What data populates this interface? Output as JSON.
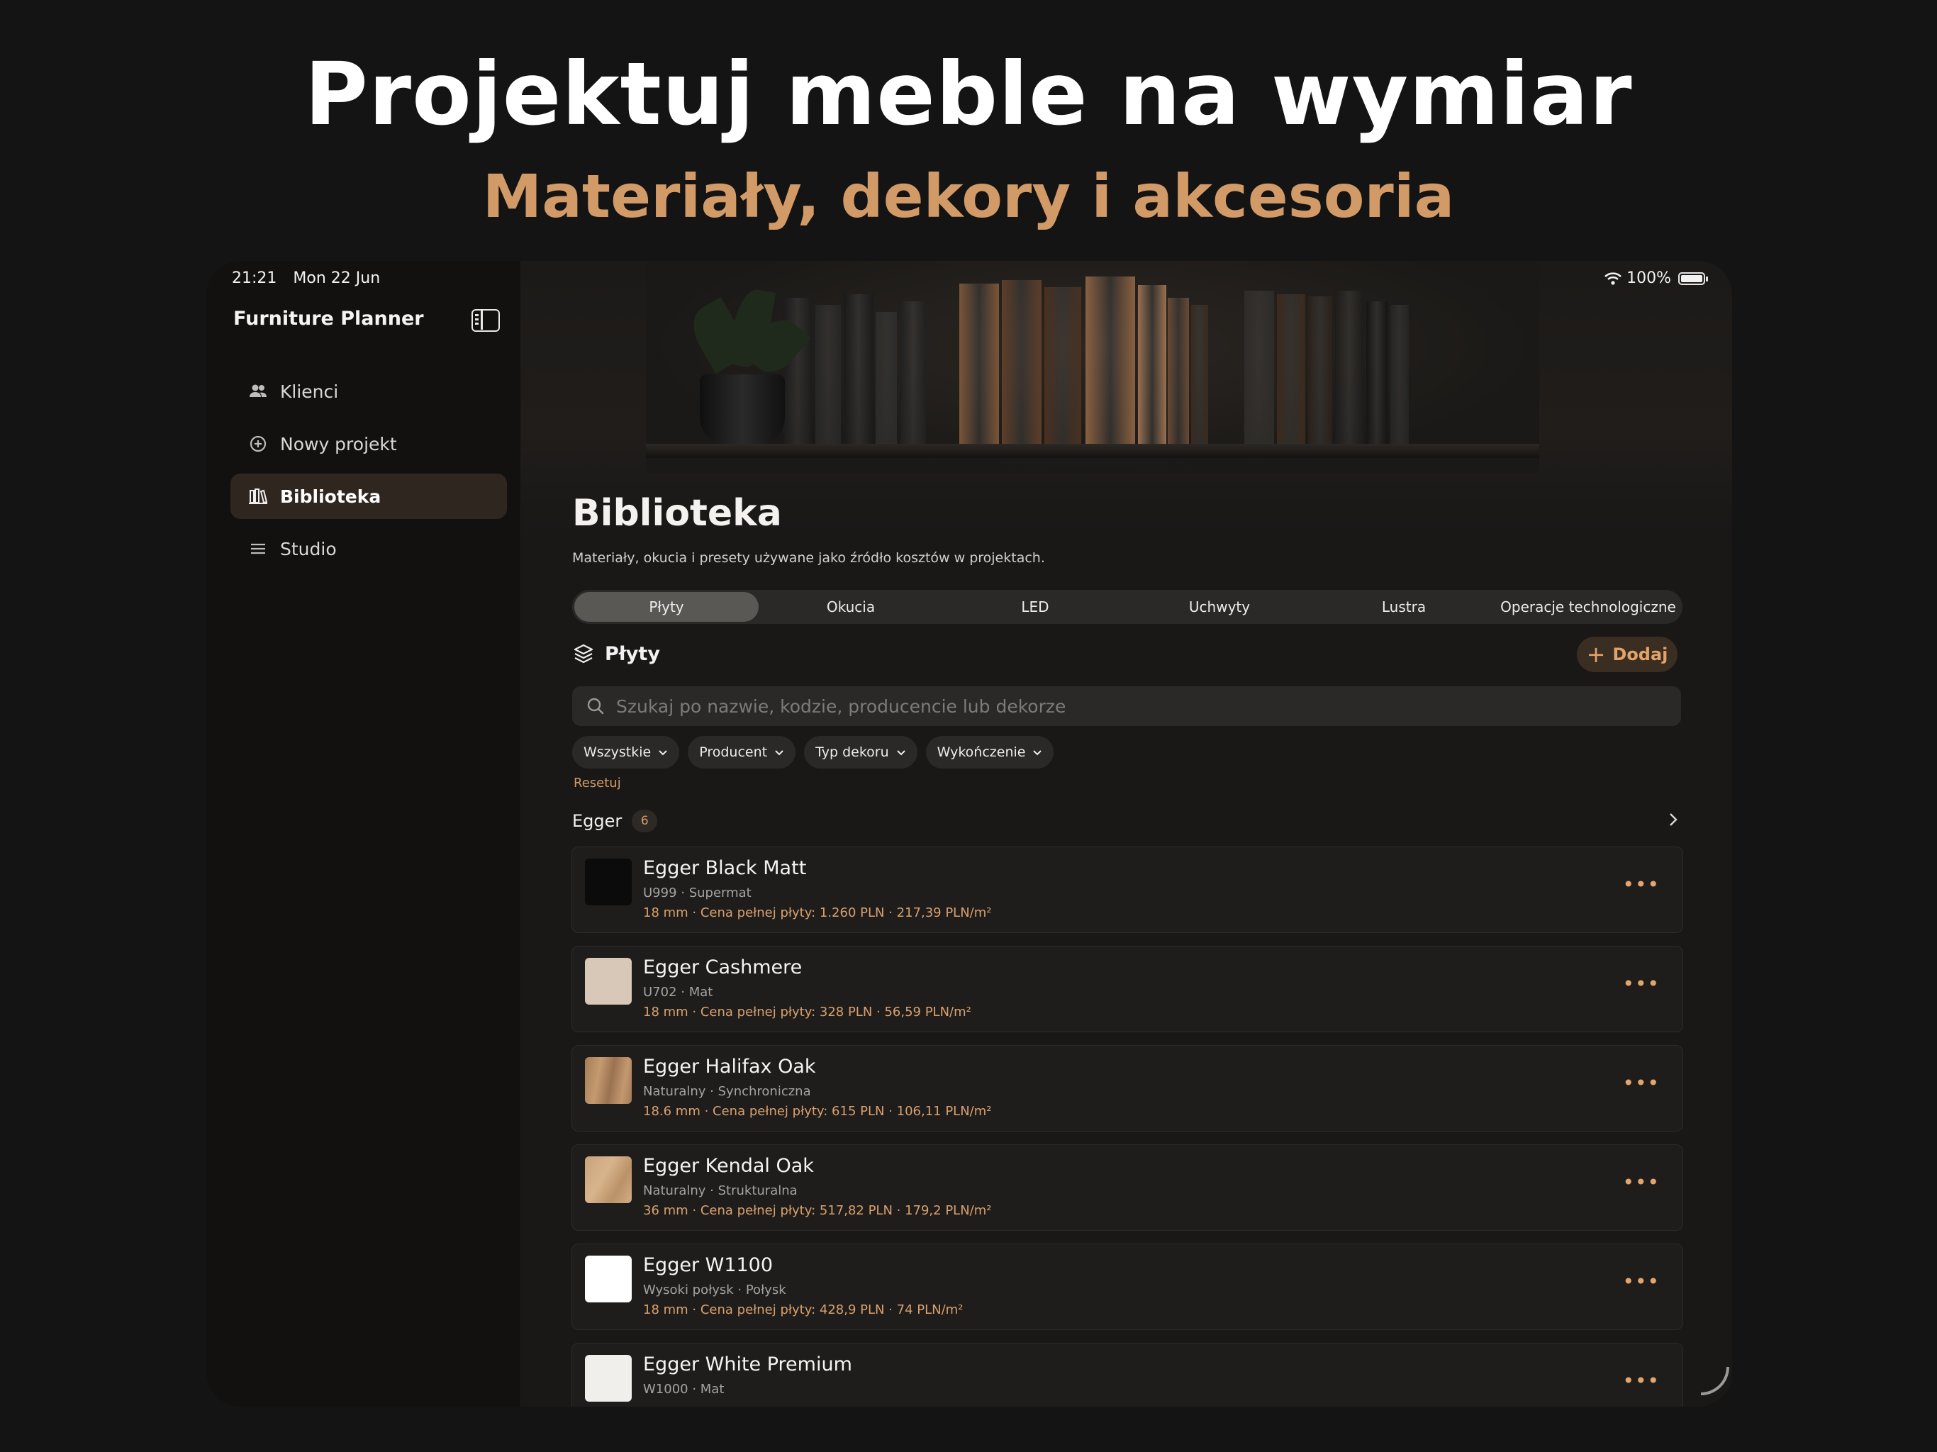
{
  "headline": "Projektuj meble na wymiar",
  "subheadline": "Materiały, dekory i akcesoria",
  "status": {
    "time": "21:21",
    "date": "Mon 22 Jun",
    "battery": "100%"
  },
  "sidebar": {
    "app_title": "Furniture Planner",
    "items": [
      {
        "label": "Klienci",
        "icon": "people-icon",
        "active": false
      },
      {
        "label": "Nowy projekt",
        "icon": "plus-circle-icon",
        "active": false
      },
      {
        "label": "Biblioteka",
        "icon": "books-icon",
        "active": true
      },
      {
        "label": "Studio",
        "icon": "lines-icon",
        "active": false
      }
    ]
  },
  "main": {
    "title": "Biblioteka",
    "description": "Materiały, okucia i presety używane jako źródło kosztów w projektach.",
    "tabs": [
      "Płyty",
      "Okucia",
      "LED",
      "Uchwyty",
      "Lustra",
      "Operacje technologiczne"
    ],
    "active_tab": "Płyty",
    "section_title": "Płyty",
    "add_label": "Dodaj",
    "search_placeholder": "Szukaj po nazwie, kodzie, producencie lub dekorze",
    "filters": [
      "Wszystkie",
      "Producent",
      "Typ dekoru",
      "Wykończenie"
    ],
    "reset_label": "Resetuj",
    "group": {
      "name": "Egger",
      "count": "6"
    },
    "items": [
      {
        "name": "Egger Black Matt",
        "sub": "U999 · Supermat",
        "meta": "18 mm · Cena pełnej płyty: 1.260 PLN · 217,39 PLN/m²",
        "swatch": "#0b0b0b"
      },
      {
        "name": "Egger Cashmere",
        "sub": "U702 · Mat",
        "meta": "18 mm · Cena pełnej płyty: 328 PLN · 56,59 PLN/m²",
        "swatch": "#d8c8b8"
      },
      {
        "name": "Egger Halifax Oak",
        "sub": "Naturalny · Synchroniczna",
        "meta": "18.6 mm · Cena pełnej płyty: 615 PLN · 106,11 PLN/m²",
        "swatch": "#b18a62"
      },
      {
        "name": "Egger Kendal Oak",
        "sub": "Naturalny · Strukturalna",
        "meta": "36 mm · Cena pełnej płyty: 517,82 PLN · 179,2 PLN/m²",
        "swatch": "#c9a27a"
      },
      {
        "name": "Egger W1100",
        "sub": "Wysoki połysk · Połysk",
        "meta": "18 mm · Cena pełnej płyty: 428,9 PLN · 74 PLN/m²",
        "swatch": "#ffffff"
      },
      {
        "name": "Egger White Premium",
        "sub": "W1000 · Mat",
        "meta": "",
        "swatch": "#f1efec"
      }
    ]
  },
  "colors": {
    "accent": "#d19a67",
    "background": "#141414",
    "active_nav": "#2f2620"
  }
}
